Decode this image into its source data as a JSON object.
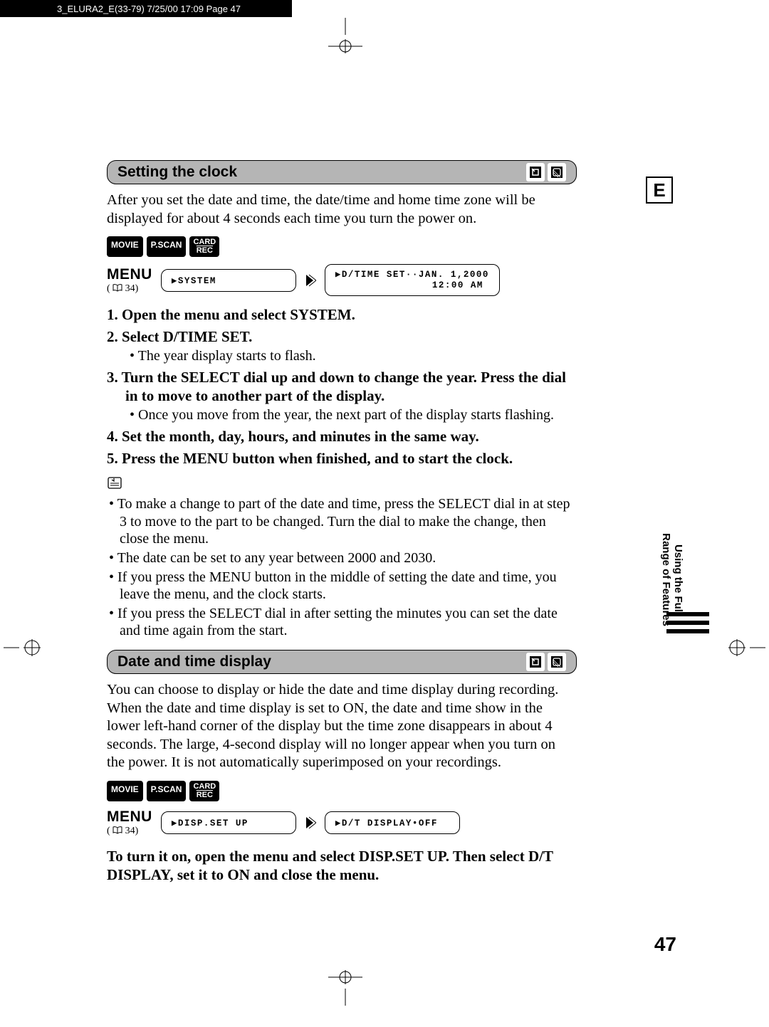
{
  "top_strip": "3_ELURA2_E(33-79)  7/25/00 17:09  Page 47",
  "e_tab": "E",
  "section1": {
    "title": "Setting the clock",
    "intro": "After you set the date and time, the date/time and home time zone will be displayed for about 4 seconds each time you turn the power on.",
    "modes": {
      "movie": "MOVIE",
      "pscan": "P.SCAN",
      "card1": "CARD",
      "card2": "REC"
    },
    "menu_word": "MENU",
    "menu_ref": "(     34)",
    "box1": "▶SYSTEM",
    "box2_line1": "▶D/TIME SET··JAN. 1,2000",
    "box2_line2": "12:00 AM",
    "steps": {
      "s1": "Open the menu and select SYSTEM.",
      "s2": "Select D/TIME SET.",
      "s2_sub": "The year display starts to flash.",
      "s3": "Turn the SELECT dial up and down to change the year. Press the dial in to move to another part of the display.",
      "s3_sub": "Once you move from the year, the next part of the display starts flashing.",
      "s4": "Set the month, day, hours, and minutes in the same way.",
      "s5": "Press the MENU button when finished, and to start the clock."
    },
    "notes": {
      "n1": "To make a change to part of the date and time, press the SELECT dial in at step 3 to move to the part to be changed. Turn the dial to make the change, then close the menu.",
      "n2": "The date can be set to any year between 2000 and 2030.",
      "n3": "If you press the MENU button in the middle of setting the date and time, you leave the menu, and the clock starts.",
      "n4": "If you press the SELECT dial in after setting the minutes you can set the date and time again from the start."
    }
  },
  "section2": {
    "title": "Date and time display",
    "intro": "You can choose to display or hide the date and time display during recording. When the date and time display is set to ON, the date and time show in the lower left-hand corner of the display but the time zone disappears in about 4 seconds. The large, 4-second display will no longer appear when you turn on the power. It is not automatically superimposed on your recordings.",
    "modes": {
      "movie": "MOVIE",
      "pscan": "P.SCAN",
      "card1": "CARD",
      "card2": "REC"
    },
    "menu_word": "MENU",
    "menu_ref": "(     34)",
    "box1": "▶DISP.SET UP",
    "box2": "▶D/T DISPLAY•OFF",
    "instruction": "To turn it on, open the menu and select DISP.SET UP. Then select D/T DISPLAY, set it to ON and close the menu."
  },
  "side_tab_line1": "Using the Full",
  "side_tab_line2": "Range of Features",
  "page_number": "47"
}
